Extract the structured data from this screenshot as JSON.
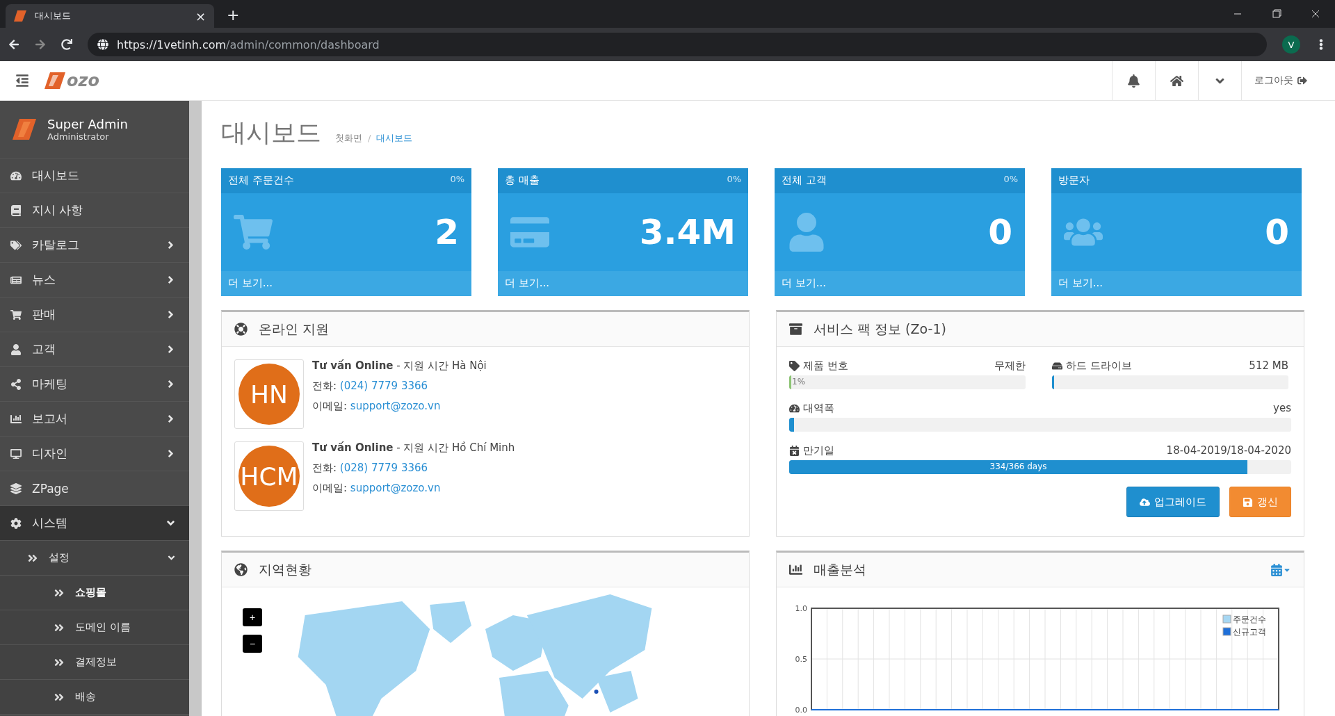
{
  "browser": {
    "tab_title": "대시보드",
    "tab_close": "×",
    "new_tab": "+",
    "url_host": "https://1vetinh.com",
    "url_path": "/admin/common/dashboard",
    "profile": "V"
  },
  "header": {
    "logo": "ozo",
    "logout": "로그아웃"
  },
  "sidebar": {
    "user": {
      "name": "Super Admin",
      "role": "Administrator"
    },
    "items": [
      {
        "label": "대시보드",
        "has_children": false,
        "expanded": false,
        "selected": false
      },
      {
        "label": "지시 사항",
        "has_children": false,
        "expanded": false,
        "selected": false
      },
      {
        "label": "카탈로그",
        "has_children": true,
        "expanded": false,
        "selected": false
      },
      {
        "label": "뉴스",
        "has_children": true,
        "expanded": false,
        "selected": false
      },
      {
        "label": "판매",
        "has_children": true,
        "expanded": false,
        "selected": false
      },
      {
        "label": "고객",
        "has_children": true,
        "expanded": false,
        "selected": false
      },
      {
        "label": "마케팅",
        "has_children": true,
        "expanded": false,
        "selected": false
      },
      {
        "label": "보고서",
        "has_children": true,
        "expanded": false,
        "selected": false
      },
      {
        "label": "디자인",
        "has_children": true,
        "expanded": false,
        "selected": false
      },
      {
        "label": "ZPage",
        "has_children": false,
        "expanded": false,
        "selected": false
      },
      {
        "label": "시스템",
        "has_children": true,
        "expanded": true,
        "selected": false,
        "children": [
          {
            "label": "설정",
            "has_children": true,
            "expanded": true,
            "selected": false,
            "children": [
              {
                "label": "쇼핑몰",
                "selected": true
              },
              {
                "label": "도메인 이름",
                "selected": false
              },
              {
                "label": "결제정보",
                "selected": false
              },
              {
                "label": "배송",
                "selected": false
              }
            ]
          }
        ]
      }
    ]
  },
  "page": {
    "title": "대시보드",
    "breadcrumb": [
      {
        "label": "첫화면",
        "selected": false
      },
      {
        "label": "대시보드",
        "selected": true
      }
    ],
    "breadcrumb_separator": "/"
  },
  "stat_cards": [
    {
      "title": "전체 주문건수",
      "percent": "0%",
      "value": "2",
      "more": "더 보기..."
    },
    {
      "title": "총 매출",
      "percent": "0%",
      "value": "3.4M",
      "more": "더 보기..."
    },
    {
      "title": "전체 고객",
      "percent": "0%",
      "value": "0",
      "more": "더 보기..."
    },
    {
      "title": "방문자",
      "value": "0",
      "more": "더 보기..."
    }
  ],
  "online_support": {
    "title": "온라인 지원",
    "contacts": [
      {
        "avatar": "HN",
        "heading": "**Tư vấn Online** - 지원 시간 Hà Nội",
        "phone_label": "전화:",
        "phone": "(024) 7779 3366",
        "email_label": "이메일:",
        "email": "support@zozo.vn"
      },
      {
        "avatar": "HCM",
        "heading": "**Tư vấn Online** - 지원 시간 Hồ Chí Minh",
        "phone_label": "전화:",
        "phone": "(028) 7779 3366",
        "email_label": "이메일:",
        "email": "support@zozo.vn"
      }
    ]
  },
  "service_pack": {
    "title": "서비스 팩 정보 (Zo-1)",
    "meters": [
      {
        "label": "제품 번호",
        "value": "무제한",
        "level": 0.01,
        "bar_text": "1%",
        "color": "#8cc474"
      },
      {
        "label": "하드 드라이브",
        "value": "512 MB",
        "level": 0.01,
        "color": "#1f8fcf"
      },
      {
        "label": "대역폭",
        "value": "yes",
        "level": 0.01,
        "color": "#1f8fcf"
      },
      {
        "label": "만기일",
        "value": "18-04-2019/18-04-2020",
        "level": 0.913,
        "bar_text": "334/366 days",
        "color": "#1f8fcf"
      }
    ],
    "buttons": [
      {
        "label": "업그레이드",
        "kind": "primary"
      },
      {
        "label": "갱신",
        "kind": "warning"
      }
    ]
  },
  "region_panel": {
    "title": "지역현황",
    "zoom_in": "+",
    "zoom_out": "−"
  },
  "sales_panel": {
    "title": "매출분석",
    "chart_data": {
      "type": "line",
      "grid": true,
      "legend": true,
      "ylim": [
        0,
        1
      ],
      "yticks": [
        {
          "value": 0,
          "label": "0.0"
        },
        {
          "value": 0.5,
          "label": "0.5"
        },
        {
          "value": 1,
          "label": "1.0"
        }
      ],
      "series": [
        {
          "name": "주문건수",
          "color": "#a6d7f3",
          "values": [
            null,
            null,
            null,
            null,
            null,
            null,
            null,
            null,
            null,
            null,
            null,
            null,
            null,
            null,
            null,
            null,
            null,
            null,
            null,
            null,
            null,
            null,
            null,
            null,
            null,
            null,
            null,
            null,
            null,
            null,
            null
          ]
        },
        {
          "name": "신규고객",
          "color": "#1f6fd8",
          "values": [
            0,
            0,
            0,
            0,
            0,
            0,
            0,
            0,
            0,
            0,
            0,
            0,
            0,
            0,
            0,
            0,
            0,
            0,
            0,
            0,
            0,
            0,
            0,
            0,
            0,
            0,
            0,
            0,
            0,
            0,
            0
          ]
        }
      ]
    }
  }
}
